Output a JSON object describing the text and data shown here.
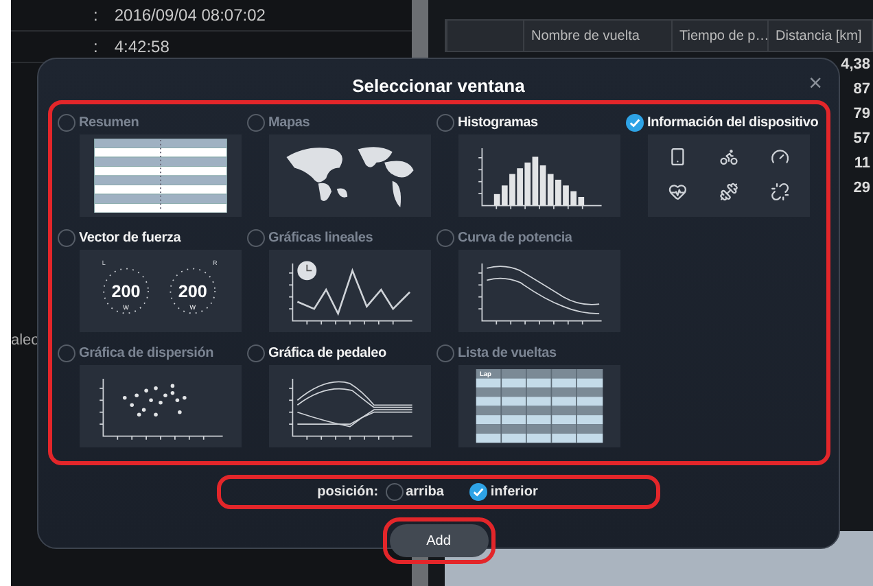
{
  "background": {
    "summary_rows": [
      {
        "separator": ":",
        "value": "2016/09/04 08:07:02"
      },
      {
        "separator": ":",
        "value": "4:42:58"
      }
    ],
    "side_label": "aleo",
    "table": {
      "columns": [
        "Nombre de vuelta",
        "Tiempo de p…",
        "Distancia [km]"
      ],
      "values": [
        "4,38",
        "87",
        "79",
        "57",
        "11",
        "29"
      ]
    }
  },
  "dialog": {
    "title": "Seleccionar ventana",
    "close": "×",
    "highlighted": true,
    "windows": [
      {
        "label": "Resumen",
        "kind": "table",
        "disabled": true,
        "checked": false
      },
      {
        "label": "Mapas",
        "kind": "map",
        "disabled": true,
        "checked": false
      },
      {
        "label": "Histogramas",
        "kind": "histogram",
        "disabled": false,
        "checked": false
      },
      {
        "label": "Información del dispositivo",
        "kind": "device",
        "disabled": false,
        "checked": true
      },
      {
        "label": "Vector de fuerza",
        "kind": "force",
        "disabled": false,
        "checked": false,
        "readings": [
          "200",
          "200"
        ],
        "units": [
          "W",
          "W"
        ],
        "sides": [
          "L",
          "R"
        ]
      },
      {
        "label": "Gráficas lineales",
        "kind": "line",
        "disabled": true,
        "checked": false
      },
      {
        "label": "Curva de potencia",
        "kind": "power",
        "disabled": true,
        "checked": false
      },
      {
        "label": "Gráfica de dispersión",
        "kind": "scatter",
        "disabled": true,
        "checked": false
      },
      {
        "label": "Gráfica de pedaleo",
        "kind": "pedal",
        "disabled": false,
        "checked": false
      },
      {
        "label": "Lista de vueltas",
        "kind": "laps",
        "disabled": true,
        "checked": false,
        "header": "Lap"
      }
    ],
    "position": {
      "label": "posición:",
      "highlighted": true,
      "options": [
        {
          "label": "arriba",
          "selected": false
        },
        {
          "label": "inferior",
          "selected": true
        }
      ]
    },
    "add_button": {
      "label": "Add",
      "highlighted": true
    }
  }
}
